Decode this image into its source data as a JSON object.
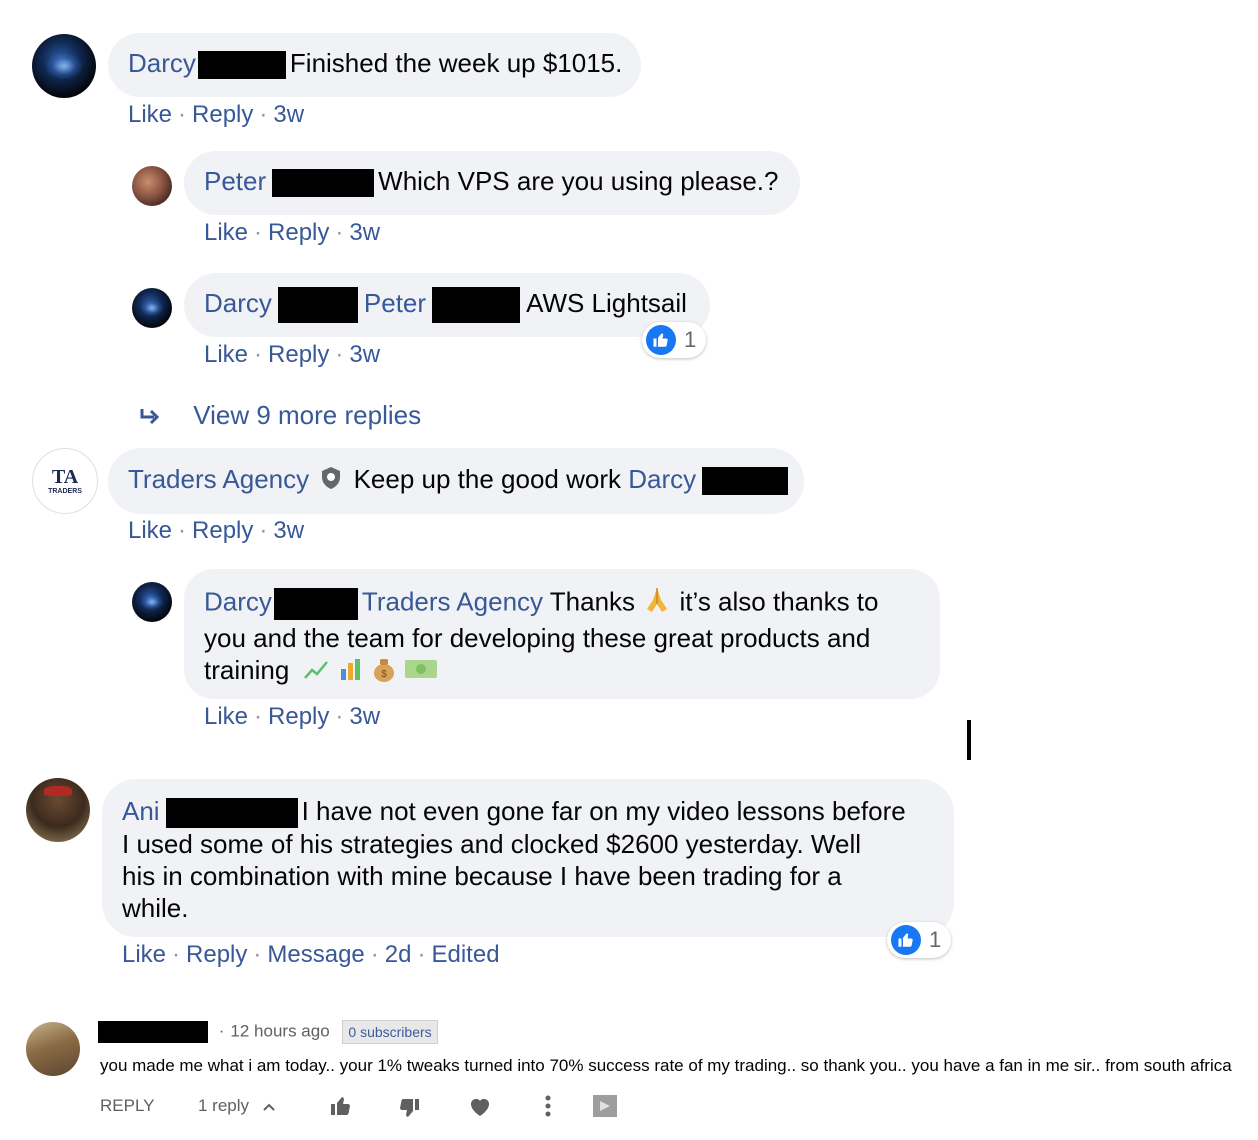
{
  "comments": [
    {
      "author": "Darcy",
      "text": "Finished the week up $1015.",
      "actions": {
        "like": "Like",
        "reply": "Reply",
        "time": "3w"
      }
    },
    {
      "author": "Peter",
      "text": "Which VPS are you using please.?",
      "actions": {
        "like": "Like",
        "reply": "Reply",
        "time": "3w"
      }
    },
    {
      "author": "Darcy",
      "mention": "Peter",
      "text": "AWS Lightsail",
      "reaction_count": "1",
      "actions": {
        "like": "Like",
        "reply": "Reply",
        "time": "3w"
      }
    },
    {
      "author": "Traders Agency",
      "text": "Keep up the good work",
      "mention": "Darcy",
      "avatar_logo_text": "TRADERS",
      "actions": {
        "like": "Like",
        "reply": "Reply",
        "time": "3w"
      }
    },
    {
      "author": "Darcy",
      "mention": "Traders Agency",
      "line1": "Thanks",
      "line1b": "it’s also thanks to",
      "line2": "you and the team for developing these great products and",
      "line3": "training",
      "actions": {
        "like": "Like",
        "reply": "Reply",
        "time": "3w"
      }
    },
    {
      "author": "Ani",
      "line1": "I have not even gone far on my video lessons before",
      "line2": "I used some of his strategies and clocked $2600 yesterday. Well",
      "line3": "his in combination with mine because I have been trading for a",
      "line4": "while.",
      "reaction_count": "1",
      "actions": {
        "like": "Like",
        "reply": "Reply",
        "message": "Message",
        "time": "2d",
        "edited": "Edited"
      }
    }
  ],
  "view_more": "View 9 more replies",
  "youtube": {
    "time": "12 hours ago",
    "badge": "0 subscribers",
    "text": "you made me what  i am today.. your 1% tweaks turned into 70% success rate of my trading.. so thank you.. you have a fan in me sir.. from south africa",
    "reply_label": "REPLY",
    "replies": "1 reply"
  }
}
